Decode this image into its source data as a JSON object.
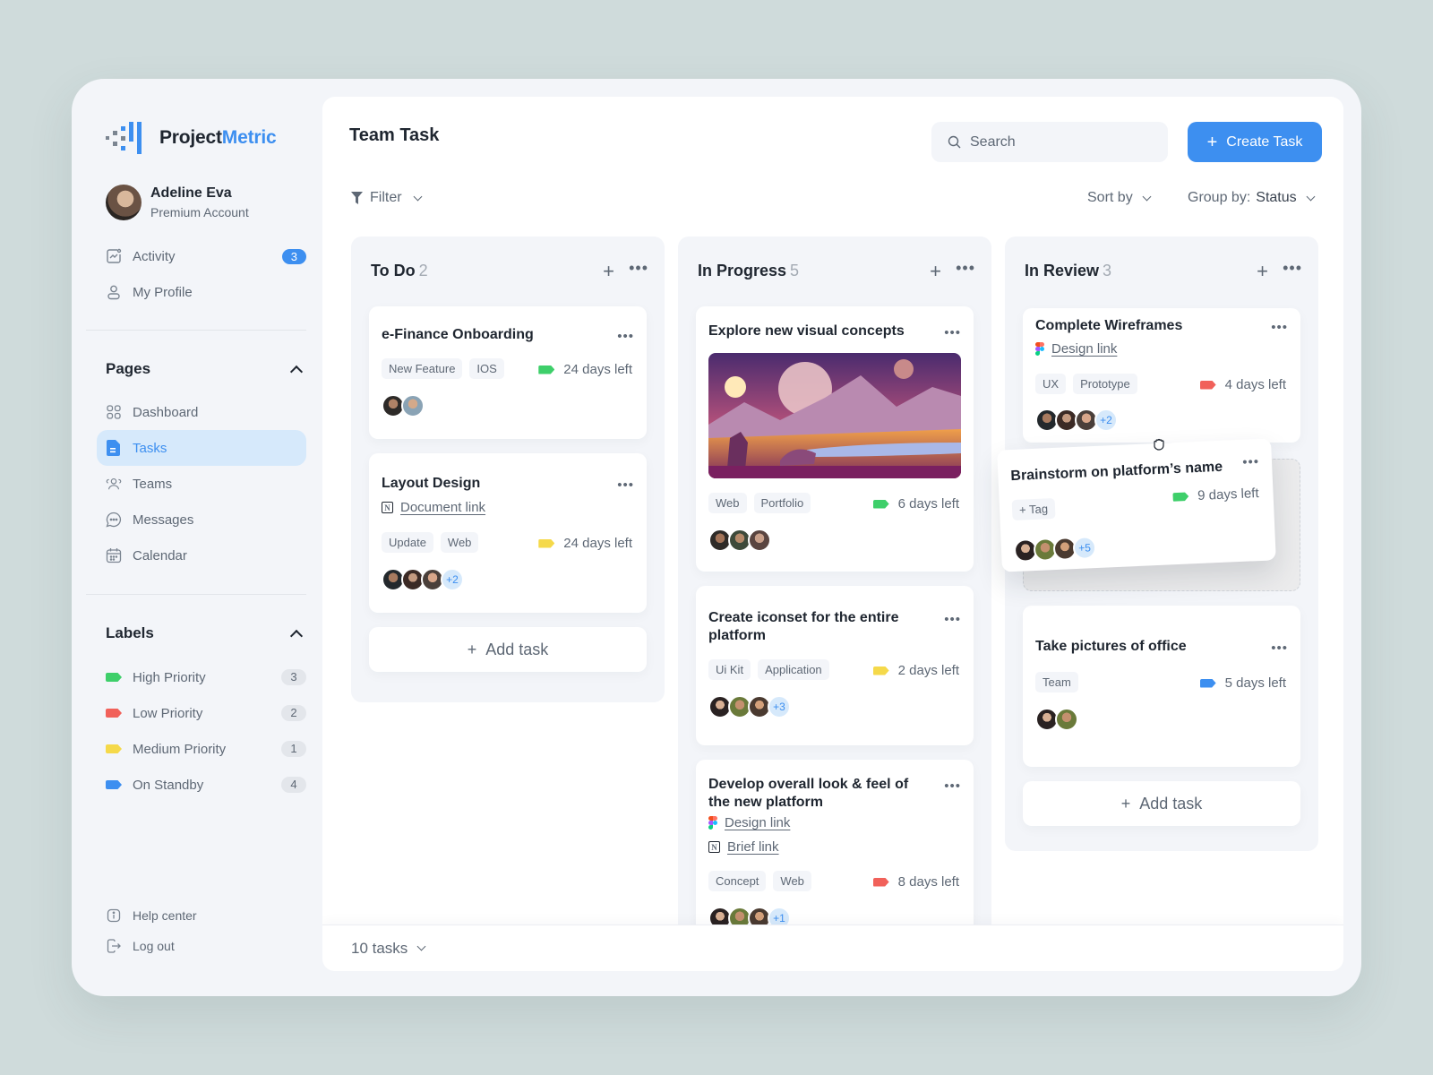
{
  "brand": {
    "name_part1": "Project",
    "name_part2": "Metric",
    "accent": "#3d8ff0"
  },
  "user": {
    "name": "Adeline Eva",
    "plan": "Premium Account"
  },
  "top_nav": [
    {
      "label": "Activity",
      "icon": "activity-icon",
      "badge": "3"
    },
    {
      "label": "My Profile",
      "icon": "user-icon"
    }
  ],
  "pages": {
    "title": "Pages",
    "items": [
      {
        "label": "Dashboard",
        "icon": "grid-icon",
        "active": false
      },
      {
        "label": "Tasks",
        "icon": "document-icon",
        "active": true
      },
      {
        "label": "Teams",
        "icon": "team-icon",
        "active": false
      },
      {
        "label": "Messages",
        "icon": "chat-icon",
        "active": false
      },
      {
        "label": "Calendar",
        "icon": "calendar-icon",
        "active": false
      }
    ]
  },
  "labels": {
    "title": "Labels",
    "items": [
      {
        "label": "High Priority",
        "color": "#3ecf6a",
        "count": "3"
      },
      {
        "label": "Low Priority",
        "color": "#f1615a",
        "count": "2"
      },
      {
        "label": "Medium Priority",
        "color": "#f5d94a",
        "count": "1"
      },
      {
        "label": "On Standby",
        "color": "#3d8ff0",
        "count": "4"
      }
    ]
  },
  "bottom_nav": [
    {
      "label": "Help center",
      "icon": "info-icon"
    },
    {
      "label": "Log out",
      "icon": "logout-icon"
    }
  ],
  "header": {
    "title": "Team Task",
    "search_placeholder": "Search",
    "create_label": "Create Task",
    "filter_label": "Filter",
    "sort_label": "Sort by",
    "group_prefix": "Group by:",
    "group_value": "Status"
  },
  "columns": [
    {
      "title": "To Do",
      "count": "2",
      "add_label": "Add task",
      "cards": [
        {
          "title": "e-Finance Onboarding",
          "tags": [
            "New Feature",
            "IOS"
          ],
          "due": "24 days left",
          "label_color": "#3ecf6a",
          "extra": ""
        },
        {
          "title": "Layout Design",
          "link_type": "notion",
          "link": "Document link",
          "tags": [
            "Update",
            "Web"
          ],
          "due": "24 days left",
          "label_color": "#f5d94a",
          "extra": "+2"
        }
      ]
    },
    {
      "title": "In Progress",
      "count": "5",
      "cards": [
        {
          "title": "Explore new visual concepts",
          "has_image": true,
          "tags": [
            "Web",
            "Portfolio"
          ],
          "due": "6 days left",
          "label_color": "#3ecf6a",
          "extra": ""
        },
        {
          "title": "Create iconset for the entire platform",
          "tags": [
            "Ui Kit",
            "Application"
          ],
          "due": "2 days left",
          "label_color": "#f5d94a",
          "extra": "+3"
        },
        {
          "title": "Develop overall look & feel of the new platform",
          "links": [
            {
              "type": "figma",
              "label": "Design link"
            },
            {
              "type": "notion",
              "label": "Brief link"
            }
          ],
          "tags": [
            "Concept",
            "Web"
          ],
          "due": "8 days left",
          "label_color": "#f1615a",
          "extra": "+1"
        }
      ]
    },
    {
      "title": "In Review",
      "count": "3",
      "add_label": "Add task",
      "cards": [
        {
          "title": "Complete Wireframes",
          "link_type": "figma",
          "link": "Design link",
          "tags": [
            "UX",
            "Prototype"
          ],
          "due": "4 days left",
          "label_color": "#f1615a",
          "extra": "+2"
        },
        {
          "title": "Take pictures of office",
          "tags": [
            "Team"
          ],
          "due": "5 days left",
          "label_color": "#3d8ff0",
          "extra": ""
        }
      ]
    }
  ],
  "dragging_card": {
    "title": "Brainstorm on platform’s name",
    "tag_add": "+ Tag",
    "due": "9 days left",
    "label_color": "#3ecf6a",
    "extra": "+5"
  },
  "footer": {
    "summary": "10 tasks"
  }
}
